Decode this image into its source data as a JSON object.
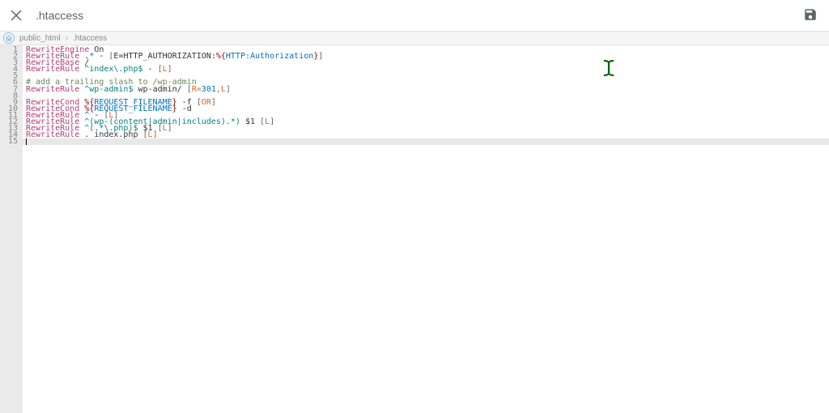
{
  "header": {
    "filename": ".htaccess"
  },
  "breadcrumb": {
    "segments": [
      "public_html",
      ".htaccess"
    ]
  },
  "code": {
    "total_lines": 15,
    "cursor_line": 15,
    "lines": [
      {
        "n": 1,
        "tokens": [
          [
            "RewriteEngine",
            "kw"
          ],
          [
            " On",
            "txt"
          ]
        ]
      },
      {
        "n": 2,
        "tokens": [
          [
            "RewriteRule",
            "kw"
          ],
          [
            " .",
            "txt"
          ],
          [
            "*",
            "rgx"
          ],
          [
            " - ",
            "txt"
          ],
          [
            "[",
            "br"
          ],
          [
            "E=HTTP_AUTHORIZATION:",
            "txt"
          ],
          [
            "%{",
            "var"
          ],
          [
            "HTTP:Authorization",
            "num"
          ],
          [
            "}",
            "var"
          ],
          [
            "]",
            "br"
          ]
        ]
      },
      {
        "n": 3,
        "tokens": [
          [
            "RewriteBase",
            "kw"
          ],
          [
            " /",
            "txt"
          ]
        ]
      },
      {
        "n": 4,
        "tokens": [
          [
            "RewriteRule",
            "kw"
          ],
          [
            " ",
            "txt"
          ],
          [
            "^index\\.php$",
            "rgx"
          ],
          [
            " - ",
            "txt"
          ],
          [
            "[",
            "br"
          ],
          [
            "L",
            "flag"
          ],
          [
            "]",
            "br"
          ]
        ]
      },
      {
        "n": 5,
        "tokens": []
      },
      {
        "n": 6,
        "tokens": [
          [
            "# add a trailing slash to /wp-admin",
            "cmt"
          ]
        ]
      },
      {
        "n": 7,
        "tokens": [
          [
            "RewriteRule",
            "kw"
          ],
          [
            " ",
            "txt"
          ],
          [
            "^wp-admin$",
            "rgx"
          ],
          [
            " wp-admin/ ",
            "txt"
          ],
          [
            "[",
            "br"
          ],
          [
            "R=",
            "flag"
          ],
          [
            "301",
            "num"
          ],
          [
            ",L",
            "flag"
          ],
          [
            "]",
            "br"
          ]
        ]
      },
      {
        "n": 8,
        "tokens": []
      },
      {
        "n": 9,
        "tokens": [
          [
            "RewriteCond",
            "kw"
          ],
          [
            " ",
            "txt"
          ],
          [
            "%{",
            "var"
          ],
          [
            "REQUEST_FILENAME",
            "num"
          ],
          [
            "}",
            "var"
          ],
          [
            " -f ",
            "txt"
          ],
          [
            "[",
            "br"
          ],
          [
            "OR",
            "flag"
          ],
          [
            "]",
            "br"
          ]
        ]
      },
      {
        "n": 10,
        "tokens": [
          [
            "RewriteCond",
            "kw"
          ],
          [
            " ",
            "txt"
          ],
          [
            "%{",
            "var"
          ],
          [
            "REQUEST_FILENAME",
            "num"
          ],
          [
            "}",
            "var"
          ],
          [
            " -d",
            "txt"
          ]
        ]
      },
      {
        "n": 11,
        "tokens": [
          [
            "RewriteRule",
            "kw"
          ],
          [
            " ",
            "txt"
          ],
          [
            "^",
            "rgx"
          ],
          [
            " - ",
            "txt"
          ],
          [
            "[",
            "br"
          ],
          [
            "L",
            "flag"
          ],
          [
            "]",
            "br"
          ]
        ]
      },
      {
        "n": 12,
        "tokens": [
          [
            "RewriteRule",
            "kw"
          ],
          [
            " ",
            "txt"
          ],
          [
            "^(wp-(content|admin|includes).*)",
            "rgx"
          ],
          [
            " $1 ",
            "txt"
          ],
          [
            "[",
            "br"
          ],
          [
            "L",
            "flag"
          ],
          [
            "]",
            "br"
          ]
        ]
      },
      {
        "n": 13,
        "tokens": [
          [
            "RewriteRule",
            "kw"
          ],
          [
            " ",
            "txt"
          ],
          [
            "^(.*\\.php)$",
            "rgx"
          ],
          [
            " $1 ",
            "txt"
          ],
          [
            "[",
            "br"
          ],
          [
            "L",
            "flag"
          ],
          [
            "]",
            "br"
          ]
        ]
      },
      {
        "n": 14,
        "tokens": [
          [
            "RewriteRule",
            "kw"
          ],
          [
            " . index.php ",
            "txt"
          ],
          [
            "[",
            "br"
          ],
          [
            "L",
            "flag"
          ],
          [
            "]",
            "br"
          ]
        ]
      },
      {
        "n": 15,
        "tokens": []
      }
    ]
  }
}
